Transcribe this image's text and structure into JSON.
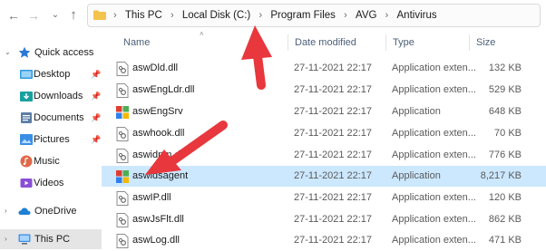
{
  "breadcrumb": [
    "This PC",
    "Local Disk (C:)",
    "Program Files",
    "AVG",
    "Antivirus"
  ],
  "sidebar": {
    "items": [
      {
        "label": "Quick access",
        "icon": "star-icon",
        "pinned": false
      },
      {
        "label": "Desktop",
        "icon": "desktop-folder-icon",
        "pinned": true
      },
      {
        "label": "Downloads",
        "icon": "downloads-folder-icon",
        "pinned": true
      },
      {
        "label": "Documents",
        "icon": "documents-folder-icon",
        "pinned": true
      },
      {
        "label": "Pictures",
        "icon": "pictures-folder-icon",
        "pinned": true
      },
      {
        "label": "Music",
        "icon": "music-folder-icon",
        "pinned": false
      },
      {
        "label": "Videos",
        "icon": "videos-folder-icon",
        "pinned": false
      },
      {
        "label": "OneDrive",
        "icon": "onedrive-cloud-icon",
        "pinned": false
      },
      {
        "label": "This PC",
        "icon": "computer-icon",
        "pinned": false,
        "selected": true
      }
    ]
  },
  "columns": {
    "name": "Name",
    "date": "Date modified",
    "type": "Type",
    "size": "Size"
  },
  "files": [
    {
      "name": "aswDld.dll",
      "date": "27-11-2021 22:17",
      "type": "Application exten...",
      "size": "132 KB",
      "icon": "dll-file-icon"
    },
    {
      "name": "aswEngLdr.dll",
      "date": "27-11-2021 22:17",
      "type": "Application exten...",
      "size": "529 KB",
      "icon": "dll-file-icon"
    },
    {
      "name": "aswEngSrv",
      "date": "27-11-2021 22:17",
      "type": "Application",
      "size": "648 KB",
      "icon": "avg-app-icon"
    },
    {
      "name": "aswhook.dll",
      "date": "27-11-2021 22:17",
      "type": "Application exten...",
      "size": "70 KB",
      "icon": "dll-file-icon"
    },
    {
      "name": "aswidpm.dll",
      "date": "27-11-2021 22:17",
      "type": "Application exten...",
      "size": "776 KB",
      "icon": "dll-file-icon"
    },
    {
      "name": "aswidsagent",
      "date": "27-11-2021 22:17",
      "type": "Application",
      "size": "8,217 KB",
      "icon": "avg-app-icon",
      "selected": true
    },
    {
      "name": "aswIP.dll",
      "date": "27-11-2021 22:17",
      "type": "Application exten...",
      "size": "120 KB",
      "icon": "dll-file-icon"
    },
    {
      "name": "aswJsFlt.dll",
      "date": "27-11-2021 22:17",
      "type": "Application exten...",
      "size": "862 KB",
      "icon": "dll-file-icon"
    },
    {
      "name": "aswLog.dll",
      "date": "27-11-2021 22:17",
      "type": "Application exten...",
      "size": "471 KB",
      "icon": "dll-file-icon"
    }
  ],
  "colors": {
    "selection": "#cce8ff",
    "annotation_arrow": "#e8383d",
    "folder": "#f3c34c"
  }
}
